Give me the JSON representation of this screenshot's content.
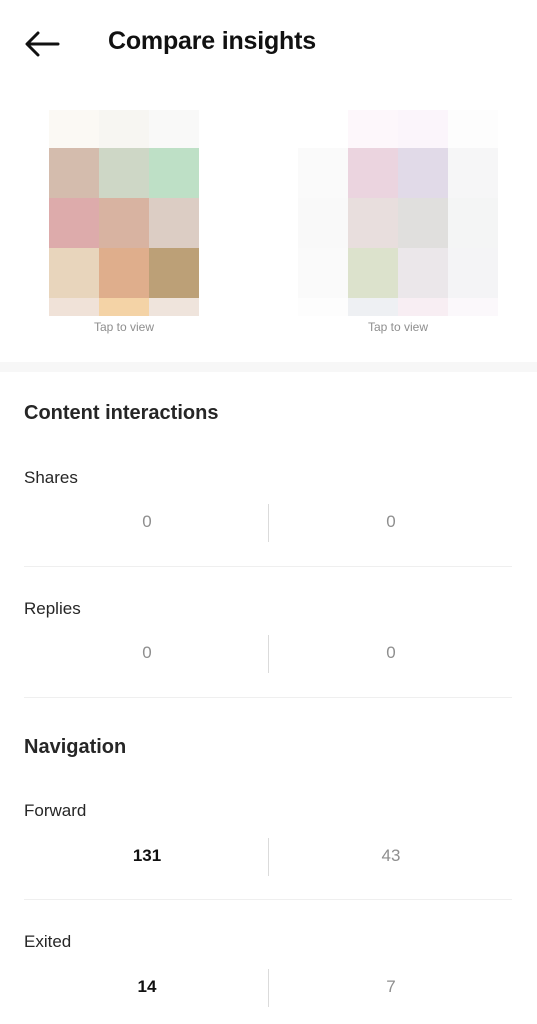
{
  "header": {
    "back_icon": "arrow-left-icon",
    "title": "Compare insights"
  },
  "thumbnails": [
    {
      "caption": "Tap to view",
      "colors": [
        "#fbf9f4",
        "#f7f6f2",
        "#f9f9f8",
        "#d4bcad",
        "#ced7c6",
        "#bee0c6",
        "#ddabab",
        "#d8b3a1",
        "#dccdc4",
        "#e8d5bc",
        "#dfae8c",
        "#bca077",
        "#f0e2d8",
        "#f4d3a6",
        "#efe4dc"
      ]
    },
    {
      "caption": "Tap to view",
      "colors": [
        "#ffffff",
        "#fdf7fb",
        "#fbf5fb",
        "#fdfdfd",
        "#fafafa",
        "#ebd4df",
        "#e1dae8",
        "#f6f6f7",
        "#f9f9f9",
        "#e8dedd",
        "#e0dfdd",
        "#f4f5f5",
        "#fafafa",
        "#dce2cc",
        "#ebe7ea",
        "#f4f4f6",
        "#fdfdfd",
        "#eef0f3",
        "#f8eef3",
        "#fbf8fb"
      ]
    }
  ],
  "content_interactions": {
    "title": "Content interactions",
    "metrics": [
      {
        "label": "Shares",
        "left": "0",
        "right": "0"
      },
      {
        "label": "Replies",
        "left": "0",
        "right": "0"
      }
    ]
  },
  "navigation": {
    "title": "Navigation",
    "metrics": [
      {
        "label": "Forward",
        "left": "131",
        "right": "43"
      },
      {
        "label": "Exited",
        "left": "14",
        "right": "7"
      }
    ]
  }
}
